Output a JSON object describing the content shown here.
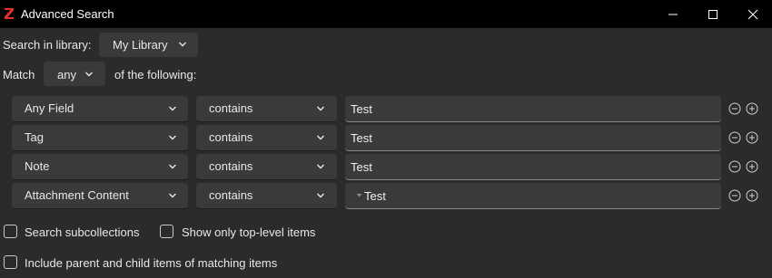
{
  "window": {
    "title": "Advanced Search",
    "app_icon": "zotero-z-icon",
    "accent": "#e5302e"
  },
  "search_in": {
    "label": "Search in library:",
    "value": "My Library"
  },
  "match": {
    "label": "Match",
    "value": "any",
    "suffix": "of the following:"
  },
  "conditions": [
    {
      "field": "Any Field",
      "operator": "contains",
      "value": "Test"
    },
    {
      "field": "Tag",
      "operator": "contains",
      "value": "Test"
    },
    {
      "field": "Note",
      "operator": "contains",
      "value": "Test"
    },
    {
      "field": "Attachment Content",
      "operator": "contains",
      "value": "Test"
    }
  ],
  "options": {
    "search_subcollections": "Search subcollections",
    "show_top_level": "Show only top-level items",
    "include_parent_child": "Include parent and child items of matching items"
  }
}
